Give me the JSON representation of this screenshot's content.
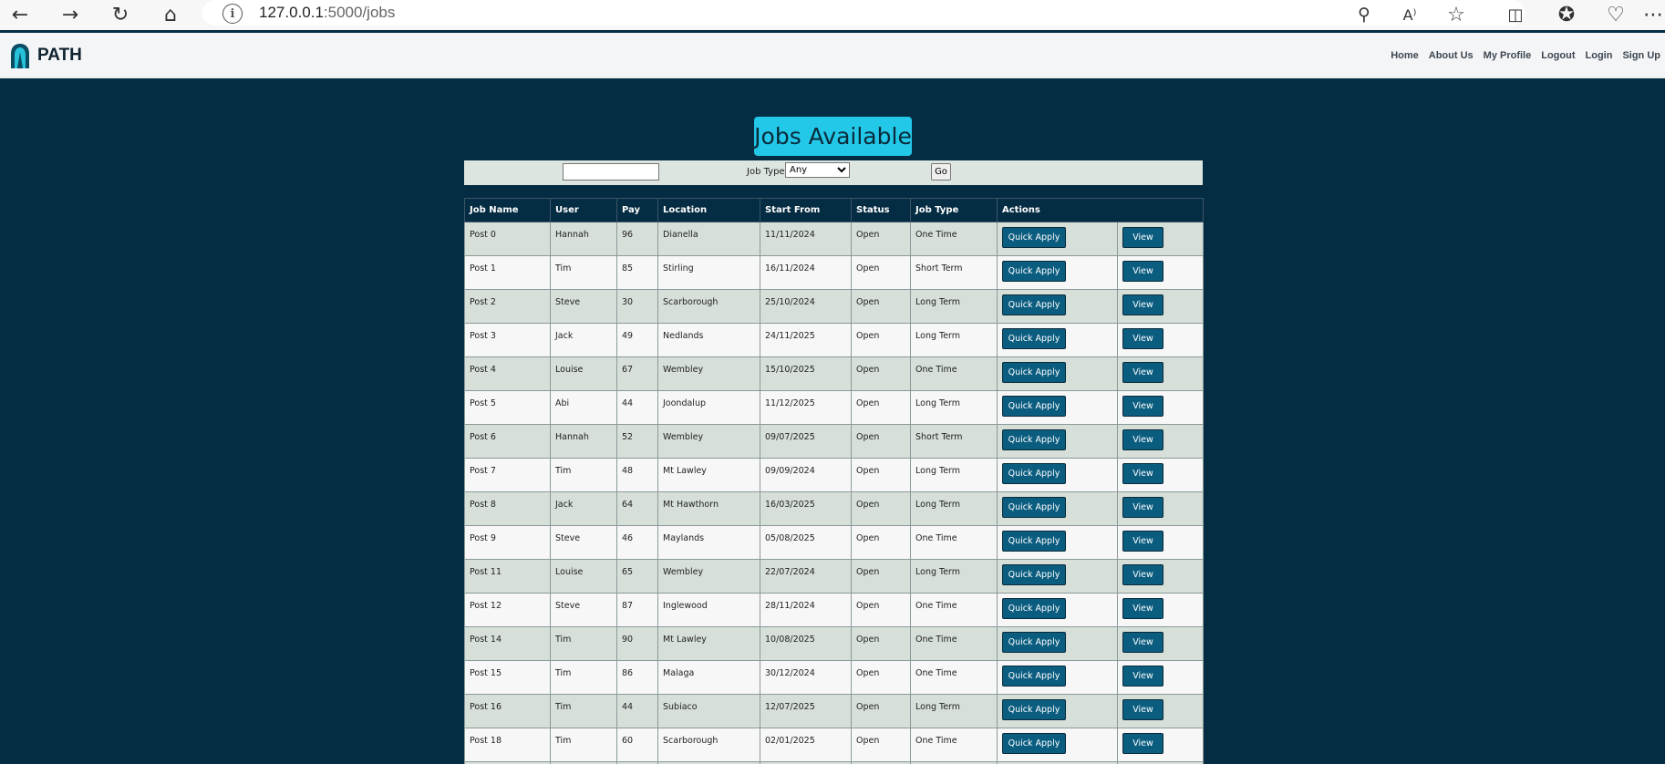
{
  "browser": {
    "url_host": "127.0.0.1",
    "url_path": ":5000/jobs"
  },
  "nav": {
    "brand": "PATH",
    "links": [
      "Home",
      "About Us",
      "My Profile",
      "Logout",
      "Login",
      "Sign Up"
    ]
  },
  "page_title": "Jobs Available",
  "filter": {
    "search_value": "",
    "job_type_label": "Job Type",
    "job_type_selected": "Any",
    "go_label": "Go"
  },
  "table": {
    "headers": [
      "Job Name",
      "User",
      "Pay",
      "Location",
      "Start From",
      "Status",
      "Job Type",
      "Actions"
    ],
    "quick_apply_label": "Quick Apply",
    "view_label": "View",
    "rows": [
      [
        "Post 0",
        "Hannah",
        "96",
        "Dianella",
        "11/11/2024",
        "Open",
        "One Time"
      ],
      [
        "Post 1",
        "Tim",
        "85",
        "Stirling",
        "16/11/2024",
        "Open",
        "Short Term"
      ],
      [
        "Post 2",
        "Steve",
        "30",
        "Scarborough",
        "25/10/2024",
        "Open",
        "Long Term"
      ],
      [
        "Post 3",
        "Jack",
        "49",
        "Nedlands",
        "24/11/2025",
        "Open",
        "Long Term"
      ],
      [
        "Post 4",
        "Louise",
        "67",
        "Wembley",
        "15/10/2025",
        "Open",
        "One Time"
      ],
      [
        "Post 5",
        "Abi",
        "44",
        "Joondalup",
        "11/12/2025",
        "Open",
        "Long Term"
      ],
      [
        "Post 6",
        "Hannah",
        "52",
        "Wembley",
        "09/07/2025",
        "Open",
        "Short Term"
      ],
      [
        "Post 7",
        "Tim",
        "48",
        "Mt Lawley",
        "09/09/2024",
        "Open",
        "Long Term"
      ],
      [
        "Post 8",
        "Jack",
        "64",
        "Mt Hawthorn",
        "16/03/2025",
        "Open",
        "Long Term"
      ],
      [
        "Post 9",
        "Steve",
        "46",
        "Maylands",
        "05/08/2025",
        "Open",
        "One Time"
      ],
      [
        "Post 11",
        "Louise",
        "65",
        "Wembley",
        "22/07/2024",
        "Open",
        "Long Term"
      ],
      [
        "Post 12",
        "Steve",
        "87",
        "Inglewood",
        "28/11/2024",
        "Open",
        "One Time"
      ],
      [
        "Post 14",
        "Tim",
        "90",
        "Mt Lawley",
        "10/08/2025",
        "Open",
        "One Time"
      ],
      [
        "Post 15",
        "Tim",
        "86",
        "Malaga",
        "30/12/2024",
        "Open",
        "One Time"
      ],
      [
        "Post 16",
        "Tim",
        "44",
        "Subiaco",
        "12/07/2025",
        "Open",
        "Long Term"
      ],
      [
        "Post 18",
        "Tim",
        "60",
        "Scarborough",
        "02/01/2025",
        "Open",
        "One Time"
      ],
      [
        "",
        "",
        "",
        "",
        "",
        "",
        ""
      ]
    ]
  }
}
